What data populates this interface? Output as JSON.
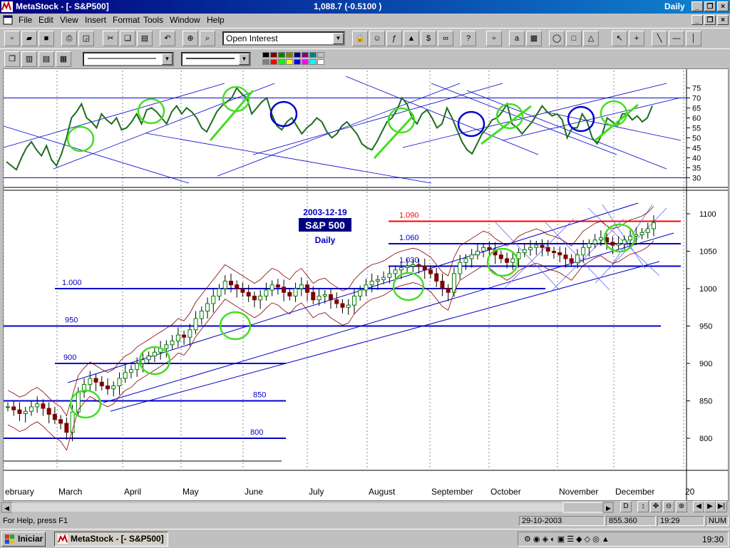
{
  "window": {
    "app_title": "MetaStock - [- S&P500]",
    "quote": "1,088.7 (-0.5100 )",
    "period": "Daily"
  },
  "menu": [
    "File",
    "Edit",
    "View",
    "Insert",
    "Format",
    "Tools",
    "Window",
    "Help"
  ],
  "toolbar": {
    "indicator_combo": "Open Interest"
  },
  "palette_colors": [
    "#000000",
    "#800000",
    "#008000",
    "#808000",
    "#000080",
    "#800080",
    "#008080",
    "#c0c0c0",
    "#808080",
    "#ff0000",
    "#00ff00",
    "#ffff00",
    "#0000ff",
    "#ff00ff",
    "#00ffff",
    "#ffffff"
  ],
  "status": {
    "help": "For Help, press F1",
    "date": "29-10-2003",
    "value": "855.360",
    "time": "19:29",
    "num": "NUM"
  },
  "taskbar": {
    "start": "Iniciar",
    "task": "MetaStock - [- S&P500]",
    "clock": "19:30"
  },
  "chart_data": [
    {
      "type": "line",
      "panel": "indicator",
      "series": [
        {
          "name": "",
          "color": "#1f6b1f",
          "values": [
            38,
            36,
            34,
            40,
            45,
            48,
            44,
            41,
            46,
            39,
            36,
            42,
            50,
            60,
            63,
            67,
            60,
            58,
            55,
            62,
            59,
            57,
            60,
            54,
            55,
            58,
            62,
            57,
            64,
            65,
            63,
            60,
            57,
            63,
            66,
            62,
            65,
            63,
            60,
            55,
            53,
            58,
            63,
            66,
            68,
            70,
            75,
            72,
            70,
            62,
            65,
            68,
            70,
            62,
            56,
            54,
            58,
            60,
            56,
            52,
            55,
            57,
            60,
            58,
            53,
            50,
            52,
            56,
            58,
            55,
            52,
            47,
            45,
            44,
            48,
            53,
            58,
            60,
            64,
            70,
            67,
            60,
            57,
            62,
            64,
            60,
            55,
            57,
            65,
            60,
            54,
            48,
            44,
            42,
            47,
            52,
            55,
            59,
            60,
            63,
            67,
            57,
            55,
            52,
            55,
            58,
            62,
            66,
            63,
            61,
            62,
            59,
            50,
            55,
            55,
            62,
            58,
            50,
            47,
            52,
            60,
            58,
            56,
            62,
            62,
            59,
            61,
            58,
            60,
            66
          ]
        }
      ],
      "ylim": [
        28,
        78
      ],
      "y_ticks": [
        30,
        35,
        40,
        45,
        50,
        55,
        60,
        65,
        70,
        75
      ]
    },
    {
      "type": "candlestick",
      "panel": "price",
      "title": "2003-12-19",
      "subtitle": "S&P 500",
      "period": "Daily",
      "x_ticks": [
        "ebruary",
        "March",
        "April",
        "May",
        "June",
        "July",
        "August",
        "September",
        "October",
        "November",
        "December",
        "20"
      ],
      "y_ticks": [
        800,
        850,
        900,
        950,
        1000,
        1050,
        1100
      ],
      "ylim": [
        760,
        1120
      ],
      "close": [
        842,
        838,
        833,
        836,
        842,
        846,
        840,
        832,
        825,
        820,
        808,
        835,
        862,
        872,
        880,
        875,
        870,
        866,
        870,
        880,
        888,
        892,
        900,
        905,
        910,
        915,
        920,
        925,
        930,
        938,
        935,
        945,
        960,
        970,
        980,
        990,
        1000,
        1010,
        1005,
        1000,
        995,
        990,
        985,
        990,
        998,
        1005,
        1002,
        995,
        990,
        1000,
        1005,
        995,
        985,
        990,
        992,
        985,
        980,
        975,
        978,
        990,
        998,
        1005,
        1010,
        1012,
        1015,
        1020,
        1025,
        1028,
        1030,
        1032,
        1030,
        1025,
        1020,
        1010,
        1000,
        995,
        1020,
        1035,
        1040,
        1045,
        1050,
        1055,
        1052,
        1045,
        1040,
        1035,
        1040,
        1048,
        1052,
        1055,
        1058,
        1055,
        1050,
        1048,
        1045,
        1040,
        1035,
        1045,
        1055,
        1060,
        1065,
        1068,
        1062,
        1058,
        1060,
        1065,
        1070,
        1072,
        1075,
        1080,
        1088
      ],
      "levels": [
        {
          "label": "1.090",
          "value": 1090,
          "color": "#ff0000"
        },
        {
          "label": "1.060",
          "value": 1060,
          "color": "#0000cc"
        },
        {
          "label": "1.030",
          "value": 1030,
          "color": "#0000cc"
        },
        {
          "label": "1.000",
          "value": 1000,
          "color": "#0000cc"
        },
        {
          "label": "950",
          "value": 950,
          "color": "#0000cc"
        },
        {
          "label": "900",
          "value": 900,
          "color": "#0000cc"
        },
        {
          "label": "850",
          "value": 850,
          "color": "#0000cc"
        },
        {
          "label": "800",
          "value": 800,
          "color": "#0000cc"
        }
      ]
    }
  ]
}
